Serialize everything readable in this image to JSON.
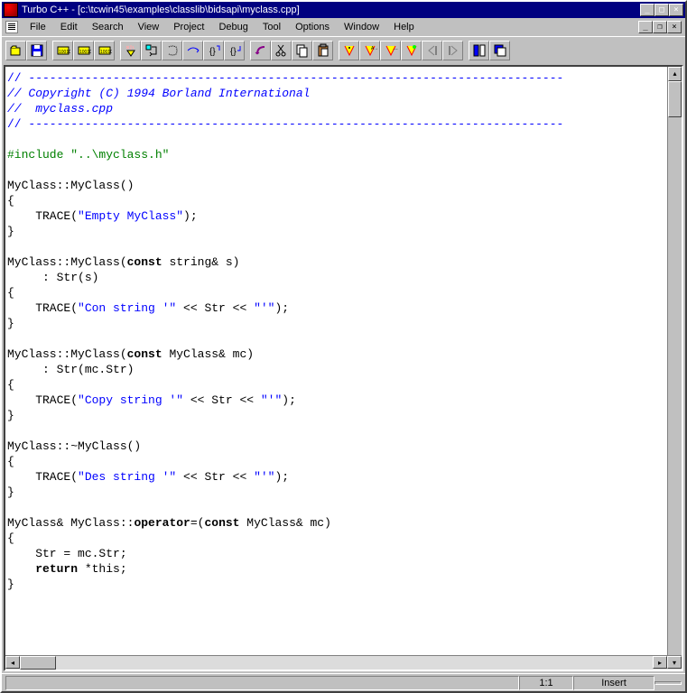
{
  "window": {
    "title": "Turbo C++ - [c:\\tcwin45\\examples\\classlib\\bidsapi\\myclass.cpp]"
  },
  "menu": {
    "items": [
      "File",
      "Edit",
      "Search",
      "View",
      "Project",
      "Debug",
      "Tool",
      "Options",
      "Window",
      "Help"
    ]
  },
  "toolbar": {
    "groups": [
      [
        "open-file-icon",
        "save-file-icon"
      ],
      [
        "undo-icon",
        "redo-icon",
        "search-file-icon"
      ],
      [
        "run-icon",
        "step-icon",
        "trace-icon",
        "step-over-icon",
        "pause-icon",
        "stop-icon"
      ],
      [
        "back-icon",
        "cut-icon",
        "copy-icon",
        "paste-icon"
      ],
      [
        "find-icon",
        "find-next-icon",
        "replace-icon",
        "bookmark-icon",
        "prev-icon",
        "next-icon"
      ],
      [
        "tile-icon",
        "cascade-icon"
      ]
    ]
  },
  "code": {
    "dash": "// ----------------------------------------------------------------------------",
    "copyright": "// Copyright (C) 1994 Borland International",
    "filename": "//  myclass.cpp",
    "include": "#include \"..\\myclass.h\"",
    "l1": "MyClass::MyClass()",
    "l2": "{",
    "l3a": "    TRACE(",
    "l3b": "\"Empty MyClass\"",
    "l3c": ");",
    "l4": "}",
    "l5a": "MyClass::MyClass(",
    "l5b": "const",
    "l5c": " string& s)",
    "l6": "     : Str(s)",
    "l7": "{",
    "l8a": "    TRACE(",
    "l8b": "\"Con string '\"",
    "l8c": " << Str << ",
    "l8d": "\"'\"",
    "l8e": ");",
    "l9": "}",
    "l10a": "MyClass::MyClass(",
    "l10b": "const",
    "l10c": " MyClass& mc)",
    "l11": "     : Str(mc.Str)",
    "l12": "{",
    "l13a": "    TRACE(",
    "l13b": "\"Copy string '\"",
    "l13c": " << Str << ",
    "l13d": "\"'\"",
    "l13e": ");",
    "l14": "}",
    "l15": "MyClass::~MyClass()",
    "l16": "{",
    "l17a": "    TRACE(",
    "l17b": "\"Des string '\"",
    "l17c": " << Str << ",
    "l17d": "\"'\"",
    "l17e": ");",
    "l18": "}",
    "l19a": "MyClass& MyClass::",
    "l19b": "operator",
    "l19c": "=(",
    "l19d": "const",
    "l19e": " MyClass& mc)",
    "l20": "{",
    "l21": "    Str = mc.Str;",
    "l22a": "    ",
    "l22b": "return",
    "l22c": " *this;",
    "l23": "}"
  },
  "status": {
    "position": "1:1",
    "mode": "Insert"
  }
}
